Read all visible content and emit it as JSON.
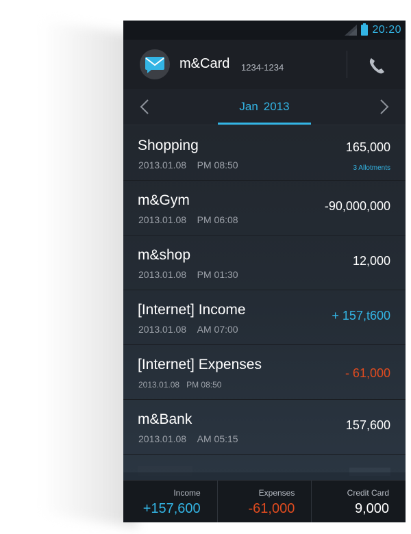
{
  "status_bar": {
    "time": "20:20",
    "icons": [
      "signal-icon",
      "battery-icon"
    ],
    "accent": "#33b5e5"
  },
  "header": {
    "title": "m&Card",
    "subtitle": "1234-1234",
    "left_icon": "message-icon",
    "right_icon": "phone-icon"
  },
  "month_nav": {
    "month": "Jan",
    "year": "2013",
    "prev_icon": "chevron-left-icon",
    "next_icon": "chevron-right-icon"
  },
  "transactions": [
    {
      "title": "Shopping",
      "date": "2013.01.08",
      "time": "PM 08:50",
      "amount": "165,000",
      "sub": "3 Allotments",
      "amount_color": "#ffffff"
    },
    {
      "title": "m&Gym",
      "date": "2013.01.08",
      "time": "PM 06:08",
      "amount": "-90,000,000",
      "amount_color": "#ffffff"
    },
    {
      "title": "m&shop",
      "date": "2013.01.08",
      "time": "PM 01:30",
      "amount": "12,000",
      "amount_color": "#ffffff"
    },
    {
      "title": "[Internet] Income",
      "date": "2013.01.08",
      "time": "AM 07:00",
      "amount": "+ 157,t600",
      "amount_color": "#33b5e5"
    },
    {
      "title": "[Internet] Expenses",
      "date": "2013.01.08",
      "time": "PM 08:50",
      "amount": "- 61,000",
      "amount_color": "#e04b1f"
    },
    {
      "title": "m&Bank",
      "date": "2013.01.08",
      "time": "AM 05:15",
      "amount": "157,600",
      "amount_color": "#ffffff"
    }
  ],
  "summary": {
    "income_label": "Income",
    "income_value": "+157,600",
    "income_color": "#33b5e5",
    "expenses_label": "Expenses",
    "expenses_value": "-61,000",
    "expenses_color": "#e04b1f",
    "card_label": "Credit Card",
    "card_value": "9,000",
    "card_color": "#ffffff"
  }
}
